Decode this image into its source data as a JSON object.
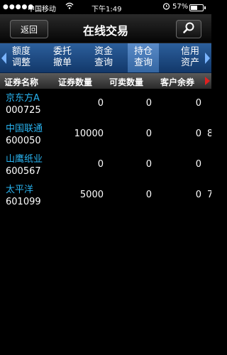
{
  "status_bar": {
    "carrier": "中国移动",
    "time": "下午1:49",
    "battery_percent": "57%",
    "battery_level": 0.57
  },
  "nav": {
    "back_label": "返回",
    "title": "在线交易"
  },
  "tabs": [
    {
      "line1": "额度",
      "line2": "调整",
      "active": false
    },
    {
      "line1": "委托",
      "line2": "撤单",
      "active": false
    },
    {
      "line1": "资金",
      "line2": "查询",
      "active": false
    },
    {
      "line1": "持仓",
      "line2": "查询",
      "active": true
    },
    {
      "line1": "信用",
      "line2": "资产",
      "active": false
    }
  ],
  "table": {
    "headers": [
      "证券名称",
      "证券数量",
      "可卖数量",
      "客户余券"
    ],
    "rows": [
      {
        "name": "京东方A",
        "code": "000725",
        "qty": "0",
        "avail": "0",
        "cust": "0",
        "clip": ""
      },
      {
        "name": "中国联通",
        "code": "600050",
        "qty": "10000",
        "avail": "0",
        "cust": "0",
        "clip": "8"
      },
      {
        "name": "山鹰纸业",
        "code": "600567",
        "qty": "0",
        "avail": "0",
        "cust": "0",
        "clip": ""
      },
      {
        "name": "太平洋",
        "code": "601099",
        "qty": "5000",
        "avail": "0",
        "cust": "0",
        "clip": "7"
      }
    ]
  },
  "colors": {
    "tab_bg": "#1f4c86",
    "header_bg": "#444444",
    "stock_name": "#29b3f0",
    "scroll_arrow": "#e02020"
  }
}
